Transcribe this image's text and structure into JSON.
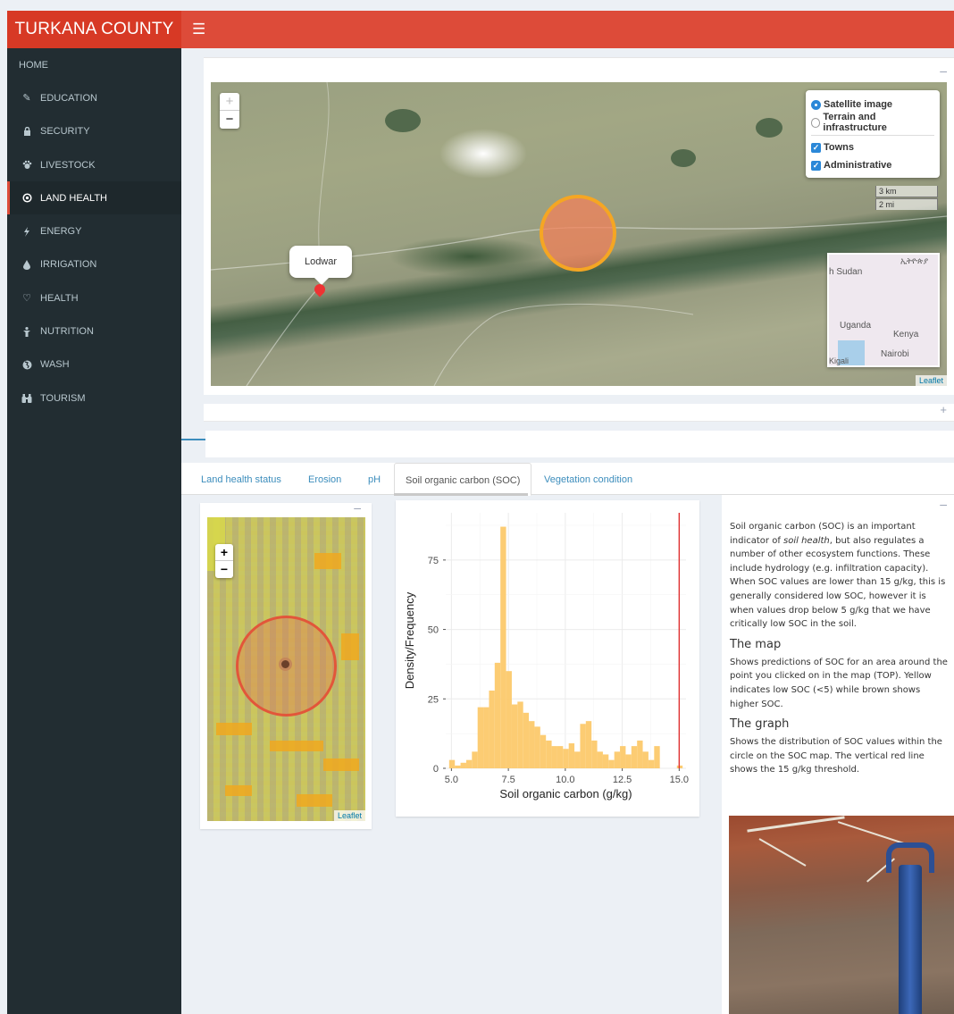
{
  "brand": "TURKANA COUNTY",
  "header": {
    "menu_icon": "hamburger-icon"
  },
  "sidebar": {
    "home": "HOME",
    "items": [
      {
        "label": "EDUCATION",
        "icon": "pencil-icon"
      },
      {
        "label": "SECURITY",
        "icon": "lock-icon"
      },
      {
        "label": "LIVESTOCK",
        "icon": "paw-icon"
      },
      {
        "label": "LAND HEALTH",
        "icon": "compass-icon",
        "active": true
      },
      {
        "label": "ENERGY",
        "icon": "bolt-icon"
      },
      {
        "label": "IRRIGATION",
        "icon": "tint-icon"
      },
      {
        "label": "HEALTH",
        "icon": "heart-icon"
      },
      {
        "label": "NUTRITION",
        "icon": "child-icon"
      },
      {
        "label": "WASH",
        "icon": "globe-icon"
      },
      {
        "label": "TOURISM",
        "icon": "binoculars-icon"
      }
    ]
  },
  "main_map": {
    "zoom_in": "+",
    "zoom_out": "−",
    "layers": {
      "base": [
        {
          "label": "Satellite image",
          "selected": true
        },
        {
          "label": "Terrain and infrastructure",
          "selected": false
        }
      ],
      "overlays": [
        {
          "label": "Towns",
          "checked": true
        },
        {
          "label": "Administrative",
          "checked": true
        }
      ]
    },
    "scale_km": "3 km",
    "scale_mi": "2 mi",
    "popup": "Lodwar",
    "minimap_labels": {
      "sudan": "h Sudan",
      "ethiopia": "ኢትዮጵያ",
      "uganda": "Uganda",
      "kenya": "Kenya",
      "nairobi": "Nairobi",
      "kigali": "Kigali"
    },
    "attribution": "Leaflet"
  },
  "tabs": [
    {
      "label": "Land health status",
      "active": false
    },
    {
      "label": "Erosion",
      "active": false
    },
    {
      "label": "pH",
      "active": false
    },
    {
      "label": "Soil organic carbon (SOC)",
      "active": true
    },
    {
      "label": "Vegetation condition",
      "active": false
    }
  ],
  "soc_map": {
    "zoom_in": "+",
    "zoom_out": "−",
    "attribution": "Leaflet"
  },
  "chart_data": {
    "type": "bar",
    "xlabel": "Soil organic carbon (g/kg)",
    "ylabel": "Density/Frequency",
    "xlim": [
      4.75,
      15.3
    ],
    "ylim": [
      0,
      92
    ],
    "xticks": [
      5.0,
      7.5,
      10.0,
      12.5,
      15.0
    ],
    "yticks": [
      0,
      25,
      50,
      75
    ],
    "bin_width": 0.25,
    "bin_starts": [
      4.9,
      5.15,
      5.4,
      5.65,
      5.9,
      6.15,
      6.4,
      6.65,
      6.9,
      7.15,
      7.4,
      7.65,
      7.9,
      8.15,
      8.4,
      8.65,
      8.9,
      9.15,
      9.4,
      9.65,
      9.9,
      10.15,
      10.4,
      10.65,
      10.9,
      11.15,
      11.4,
      11.65,
      11.9,
      12.15,
      12.4,
      12.65,
      12.9,
      13.15,
      13.4,
      13.65,
      13.9,
      14.15,
      14.4,
      14.65,
      14.9
    ],
    "frequencies": [
      3,
      1,
      2,
      3,
      6,
      22,
      22,
      28,
      38,
      87,
      35,
      23,
      24,
      20,
      17,
      15,
      12,
      10,
      8,
      8,
      7,
      9,
      6,
      16,
      17,
      10,
      6,
      5,
      3,
      6,
      8,
      5,
      8,
      10,
      6,
      3,
      8,
      0,
      0,
      0,
      1
    ],
    "vline": {
      "x": 15.0,
      "color": "#e03030"
    },
    "bar_color": "#fcc96b"
  },
  "info": {
    "intro_before": "Soil organic carbon (SOC) is an important indicator of ",
    "intro_em": "soil health",
    "intro_after": ", but also regulates a number of other ecosystem functions. These include hydrology (e.g. infiltration capacity). When SOC values are lower than 15 g/kg, this is generally considered low SOC, however it is when values drop below 5 g/kg that we have critically low SOC in the soil.",
    "map_heading": "The map",
    "map_text": "Shows predictions of SOC for an area around the point you clicked on in the map (TOP). Yellow indicates low SOC (<5) while brown shows higher SOC.",
    "graph_heading": "The graph",
    "graph_text": "Shows the distribution of SOC values within the circle on the SOC map. The vertical red line shows the 15 g/kg threshold."
  }
}
